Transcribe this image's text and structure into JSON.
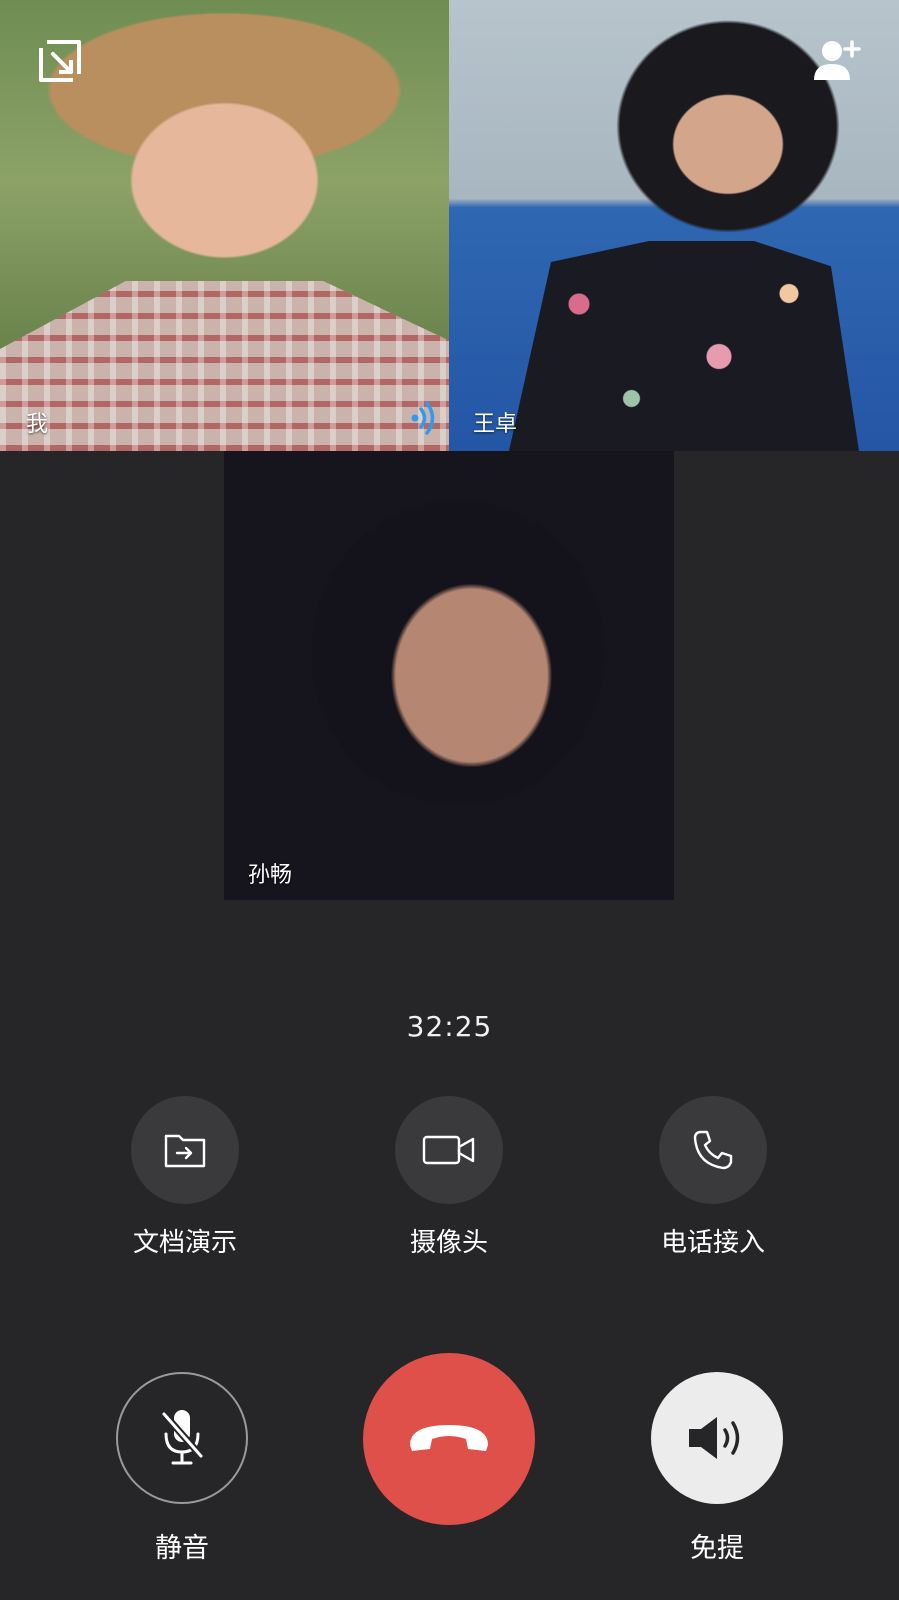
{
  "participants": [
    {
      "name": "我",
      "speaking": true
    },
    {
      "name": "王卓",
      "speaking": false
    },
    {
      "name": "孙畅",
      "speaking": false
    }
  ],
  "top_bar": {
    "minimize_icon": "minimize-window-icon",
    "add_member_icon": "add-person-icon"
  },
  "call": {
    "duration": "32:25"
  },
  "functions": {
    "doc_present": {
      "label": "文档演示",
      "icon": "folder-share-icon"
    },
    "camera": {
      "label": "摄像头",
      "icon": "video-camera-icon"
    },
    "dial_in": {
      "label": "电话接入",
      "icon": "phone-icon"
    }
  },
  "controls": {
    "mute": {
      "label": "静音",
      "icon": "microphone-off-icon"
    },
    "hangup": {
      "icon": "hang-up-icon",
      "color": "#e0504a"
    },
    "speaker": {
      "label": "免提",
      "icon": "speaker-icon"
    }
  },
  "colors": {
    "background": "#262628",
    "button": "#3a3a3c",
    "hangup": "#e0504a",
    "speaking_indicator": "#2f9bf0"
  }
}
